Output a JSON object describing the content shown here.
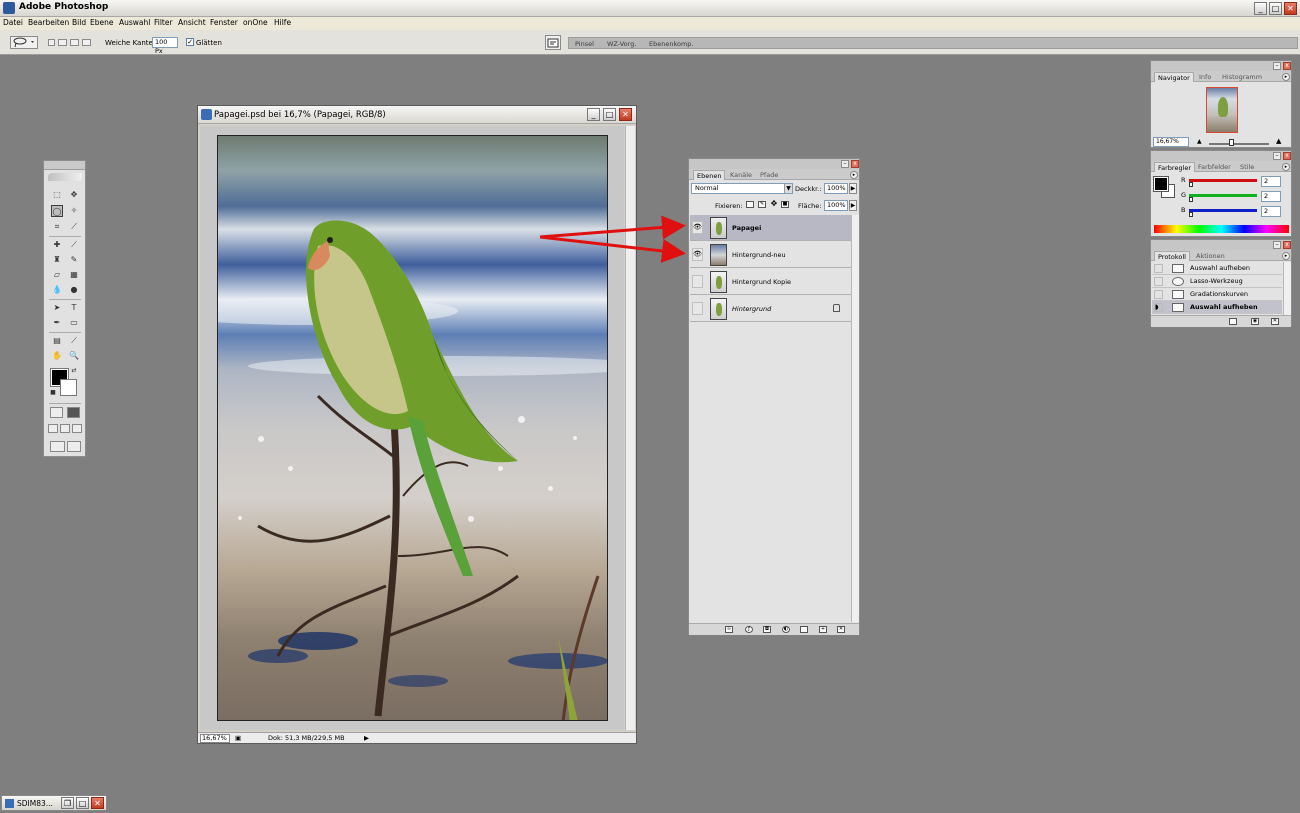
{
  "app": {
    "title": "Adobe Photoshop"
  },
  "window_controls": {
    "minimize": "_",
    "maximize": "□",
    "close": "✕"
  },
  "menu": [
    "Datei",
    "Bearbeiten",
    "Bild",
    "Ebene",
    "Auswahl",
    "Filter",
    "Ansicht",
    "Fenster",
    "onOne",
    "Hilfe"
  ],
  "options_bar": {
    "tool_icon": "lasso-icon",
    "feather_label": "Weiche Kante:",
    "feather_value": "100 Px",
    "antialias_label": "Glätten",
    "antialias_checked": true,
    "palette_well_tabs": [
      "Pinsel",
      "WZ-Vorg.",
      "Ebenenkomp."
    ]
  },
  "document": {
    "title": "Papagei.psd bei 16,7% (Papagei, RGB/8)",
    "zoom": "16,67%",
    "doc_info": "Dok: 51,3 MB/229,5 MB"
  },
  "layers_panel": {
    "tabs": [
      "Ebenen",
      "Kanäle",
      "Pfade"
    ],
    "blend_mode": "Normal",
    "opacity_label": "Deckkr.:",
    "opacity": "100%",
    "lock_label": "Fixieren:",
    "fill_label": "Fläche:",
    "fill": "100%",
    "layers": [
      {
        "name": "Papagei",
        "visible": true,
        "selected": true
      },
      {
        "name": "Hintergrund-neu",
        "visible": true,
        "selected": false
      },
      {
        "name": "Hintergrund Kopie",
        "visible": false,
        "selected": false
      },
      {
        "name": "Hintergrund",
        "visible": false,
        "selected": false,
        "locked": true
      }
    ]
  },
  "navigator_panel": {
    "tabs": [
      "Navigator",
      "Info",
      "Histogramm"
    ],
    "zoom": "16,67%"
  },
  "color_panel": {
    "tabs": [
      "Farbregler",
      "Farbfelder",
      "Stile"
    ],
    "channels": [
      {
        "label": "R",
        "value": "2",
        "color": "#d01010"
      },
      {
        "label": "G",
        "value": "2",
        "color": "#10b020"
      },
      {
        "label": "B",
        "value": "2",
        "color": "#1020c8"
      }
    ]
  },
  "history_panel": {
    "tabs": [
      "Protokoll",
      "Aktionen"
    ],
    "items": [
      {
        "label": "Auswahl aufheben",
        "current": false
      },
      {
        "label": "Lasso-Werkzeug",
        "current": false
      },
      {
        "label": "Gradationskurven",
        "current": false
      },
      {
        "label": "Auswahl aufheben",
        "current": true
      }
    ]
  },
  "taskbar": {
    "label": "SDIM83..."
  },
  "colors": {
    "workspace": "#7f7f7f",
    "annotation_arrow": "#e01010",
    "selection_row": "#b8b8c4"
  }
}
